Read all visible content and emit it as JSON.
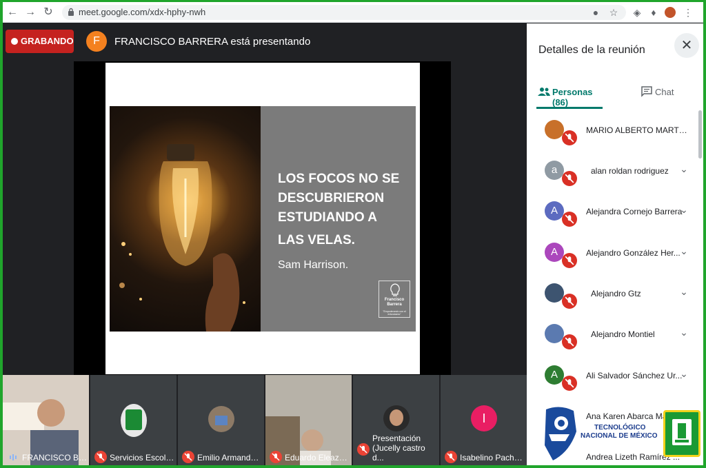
{
  "browser": {
    "url": "meet.google.com/xdx-hphy-nwh"
  },
  "stage": {
    "recording_label": "GRABANDO",
    "presenter_initial": "F",
    "presenting_text": "FRANCISCO BARRERA está presentando"
  },
  "slide": {
    "quote_lines": [
      "LOS FOCOS NO SE",
      "DESCUBRIERON",
      "ESTUDIANDO A"
    ],
    "quote_line4": "LAS VELAS.",
    "author": "Sam Harrison.",
    "logo_name_1": "Francisco",
    "logo_name_2": "Barrera",
    "logo_slogan": "\"Empoderando con el entusiasmo\""
  },
  "tiles": [
    {
      "name": "FRANCISCO BAR...",
      "color": "#5b5f66"
    },
    {
      "name": "Servicios Escolar...",
      "color": "#3c4043"
    },
    {
      "name": "Emilio Armando ...",
      "color": "#3c4043"
    },
    {
      "name": "Eduardo Eleazar ...",
      "color": "#8a8f96"
    },
    {
      "name": "Presentación (Jucelly castro d...",
      "color": "#3c4043"
    },
    {
      "name": "Isabelino Pacheco",
      "color": "#3c4043"
    }
  ],
  "tile_avatar_initial": "I",
  "panel": {
    "title": "Detalles de la reunión",
    "tab_people": "Personas (86)",
    "tab_chat": "Chat"
  },
  "people": [
    {
      "name": "MARIO ALBERTO MARTIN HER...",
      "initial": "",
      "color": "#c8702a"
    },
    {
      "name": "alan roldan rodriguez",
      "initial": "a",
      "color": "#8f9aa3"
    },
    {
      "name": "Alejandra Cornejo Barrera",
      "initial": "A",
      "color": "#5c6bc0"
    },
    {
      "name": "Alejandro González Her...",
      "initial": "A",
      "color": "#ab47bc"
    },
    {
      "name": "Alejandro Gtz",
      "initial": "",
      "color": "#3d5470"
    },
    {
      "name": "Alejandro Montiel",
      "initial": "",
      "color": "#5b7ab0"
    },
    {
      "name": "Ali Salvador Sánchez Ur...",
      "initial": "A",
      "color": "#2e7d32"
    },
    {
      "name": "Ana Karen Abarca Maza...",
      "initial": "",
      "color": "#ffffff"
    },
    {
      "name": "Andrea Lizeth Ramírez ...",
      "initial": "",
      "color": "#ffffff"
    }
  ],
  "watermark": {
    "line1": "TECNOLÓGICO",
    "line2": "NACIONAL DE MÉXICO"
  },
  "colors": {
    "frame_green": "#20a52c",
    "recording_red": "#c5221f",
    "accent_teal": "#00796b",
    "mute_red": "#d93025"
  }
}
